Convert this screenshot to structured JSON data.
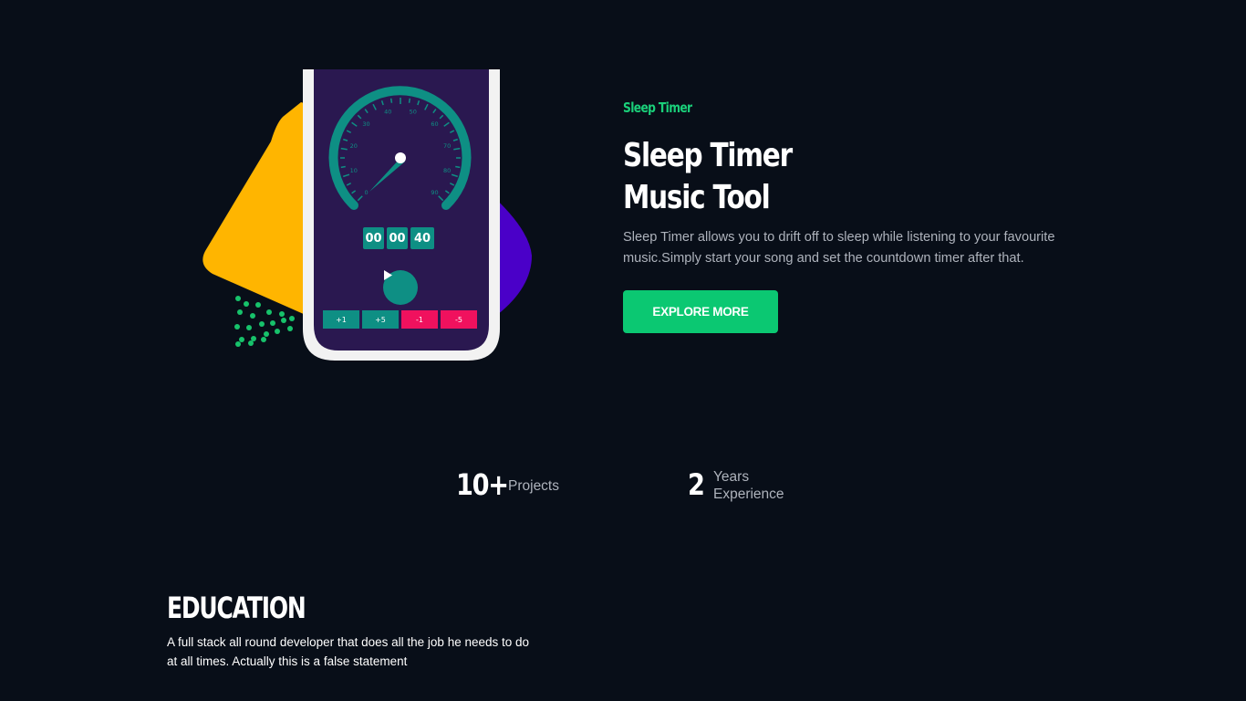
{
  "hero": {
    "eyebrow": "Sleep Timer",
    "title_line1": "Sleep Timer",
    "title_line2": "Music Tool",
    "description": "Sleep Timer allows you to drift off to sleep while listening to your favourite music.Simply start your song and set the countdown timer after that.",
    "cta_label": "EXPLORE MORE"
  },
  "phone": {
    "gauge_ticks": [
      "0",
      "10",
      "20",
      "30",
      "40",
      "50",
      "60",
      "70",
      "80",
      "90"
    ],
    "timer": [
      "00",
      "00",
      "40"
    ],
    "adjust_buttons": [
      {
        "label": "+1",
        "color": "#0e8f84"
      },
      {
        "label": "+5",
        "color": "#0e8f84"
      },
      {
        "label": "-1",
        "color": "#f0115e"
      },
      {
        "label": "-5",
        "color": "#f0115e"
      }
    ]
  },
  "stats": {
    "projects": {
      "number": "10+",
      "label": "Projects"
    },
    "years": {
      "number": "2",
      "label": "Years Experience"
    }
  },
  "education": {
    "title": "EDUCATION",
    "description": "A full stack all round developer that does all the job he needs to do at all times. Actually this is a false statement"
  },
  "colors": {
    "background": "#080e18",
    "accent_green": "#0bc872",
    "eyebrow_green": "#1ad07a",
    "shape_yellow": "#ffb500",
    "shape_purple": "#4a00c8",
    "phone_screen": "#2a1850",
    "gauge_teal": "#0e8f84",
    "minus_pink": "#f0115e"
  },
  "icons": {
    "play": "play-icon"
  }
}
